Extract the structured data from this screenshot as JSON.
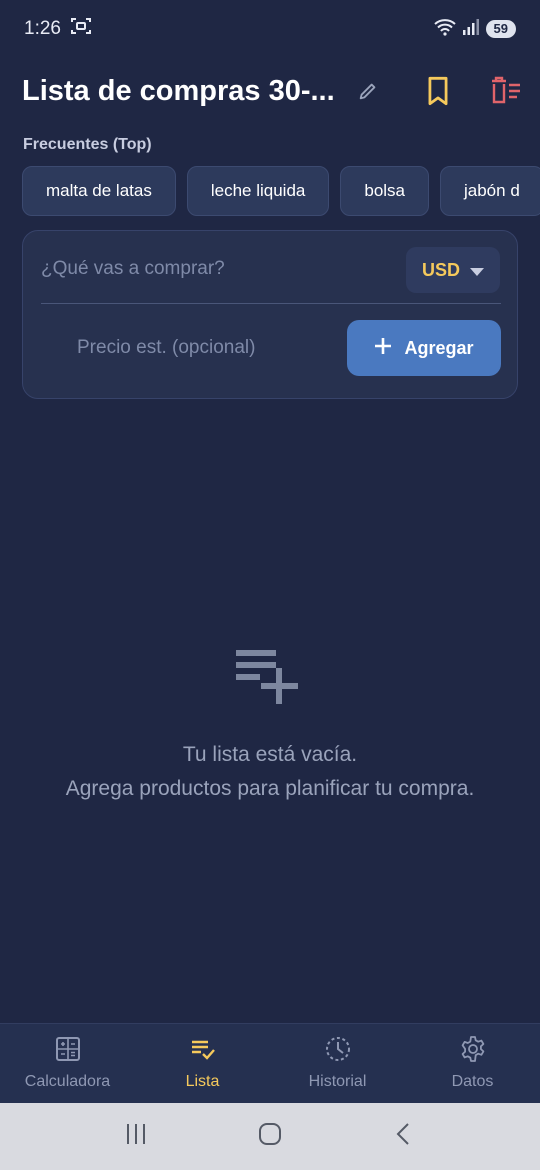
{
  "status_bar": {
    "time": "1:26",
    "battery": "59",
    "icons": [
      "screenshot-icon",
      "wifi-icon",
      "signal-icon",
      "battery-icon"
    ]
  },
  "header": {
    "title": "Lista de compras 30-...",
    "icons": [
      "edit-icon",
      "bookmark-icon",
      "delete-list-icon"
    ]
  },
  "frequent": {
    "label": "Frecuentes (Top)",
    "chips": [
      "malta de latas",
      "leche liquida",
      "bolsa",
      "jabón d"
    ]
  },
  "form": {
    "item_placeholder": "¿Qué vas a comprar?",
    "currency": "USD",
    "price_placeholder": "Precio est. (opcional)",
    "add_label": "Agregar"
  },
  "empty_state": {
    "title": "Tu lista está vacía.",
    "subtitle": "Agrega productos para planificar tu compra.",
    "icon": "playlist-add-icon"
  },
  "bottom_nav": {
    "items": [
      {
        "label": "Calculadora",
        "icon": "calculator-icon",
        "active": false
      },
      {
        "label": "Lista",
        "icon": "checklist-icon",
        "active": true
      },
      {
        "label": "Historial",
        "icon": "history-icon",
        "active": false
      },
      {
        "label": "Datos",
        "icon": "gear-icon",
        "active": false
      }
    ]
  },
  "colors": {
    "background": "#1f2744",
    "accent": "#f5c95c",
    "primary_button": "#4a79c0",
    "danger": "#e0646a"
  }
}
